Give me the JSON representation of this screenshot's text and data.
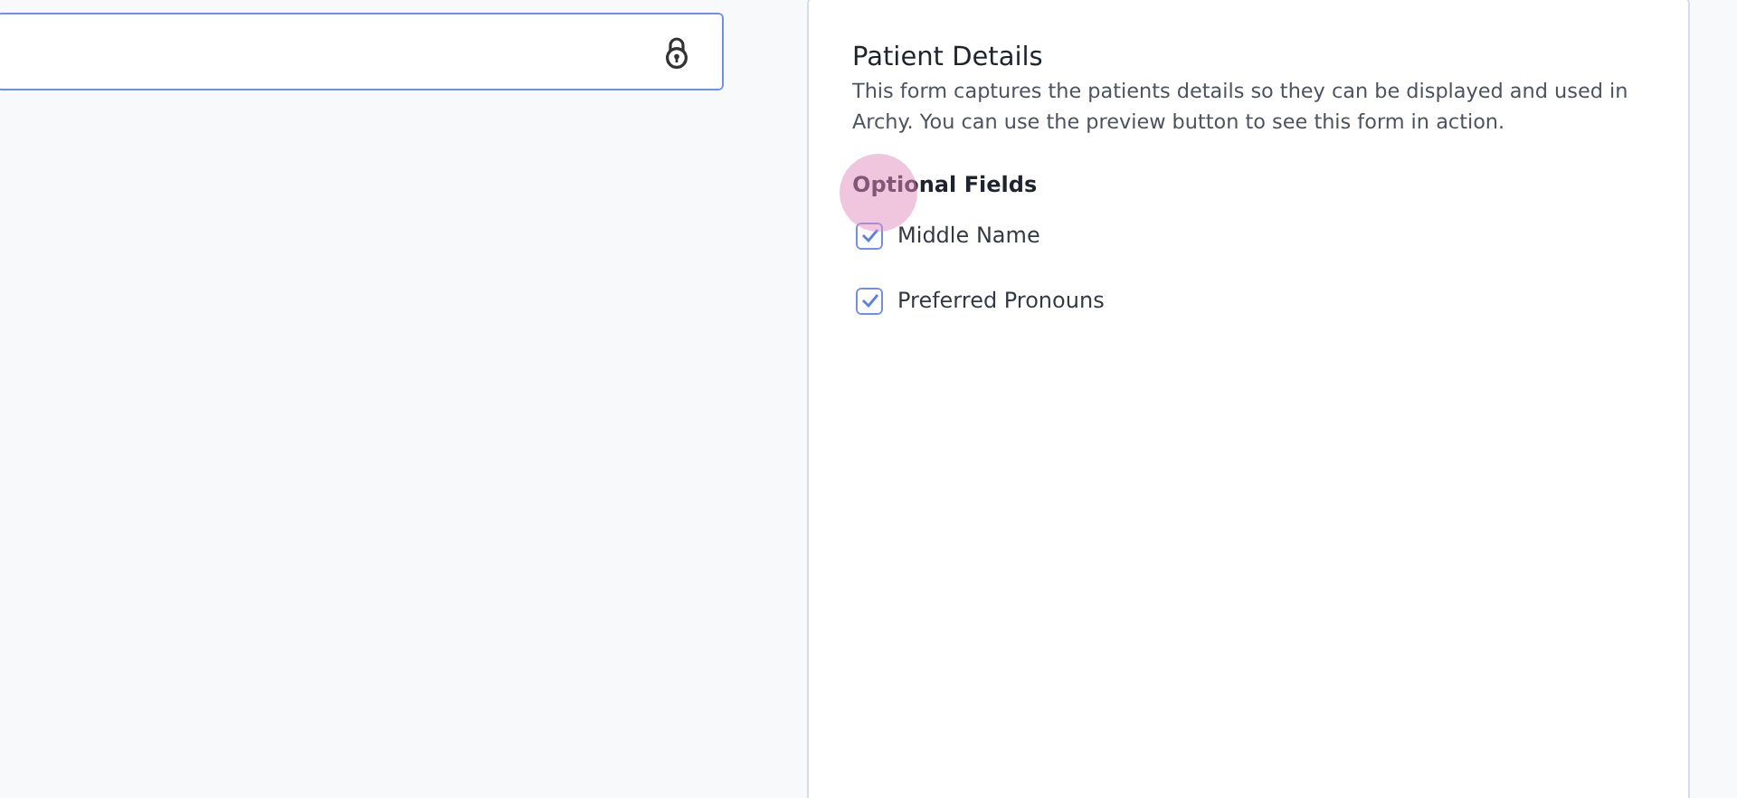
{
  "locked_field": {
    "locked": true
  },
  "panel": {
    "title": "Patient Details",
    "description": "This form captures the patients details so they can be displayed and used in Archy. You can use the preview button to see this form in action.",
    "section_title": "Optional Fields",
    "options": [
      {
        "label": "Middle Name",
        "checked": true
      },
      {
        "label": "Preferred Pronouns",
        "checked": true
      }
    ]
  }
}
